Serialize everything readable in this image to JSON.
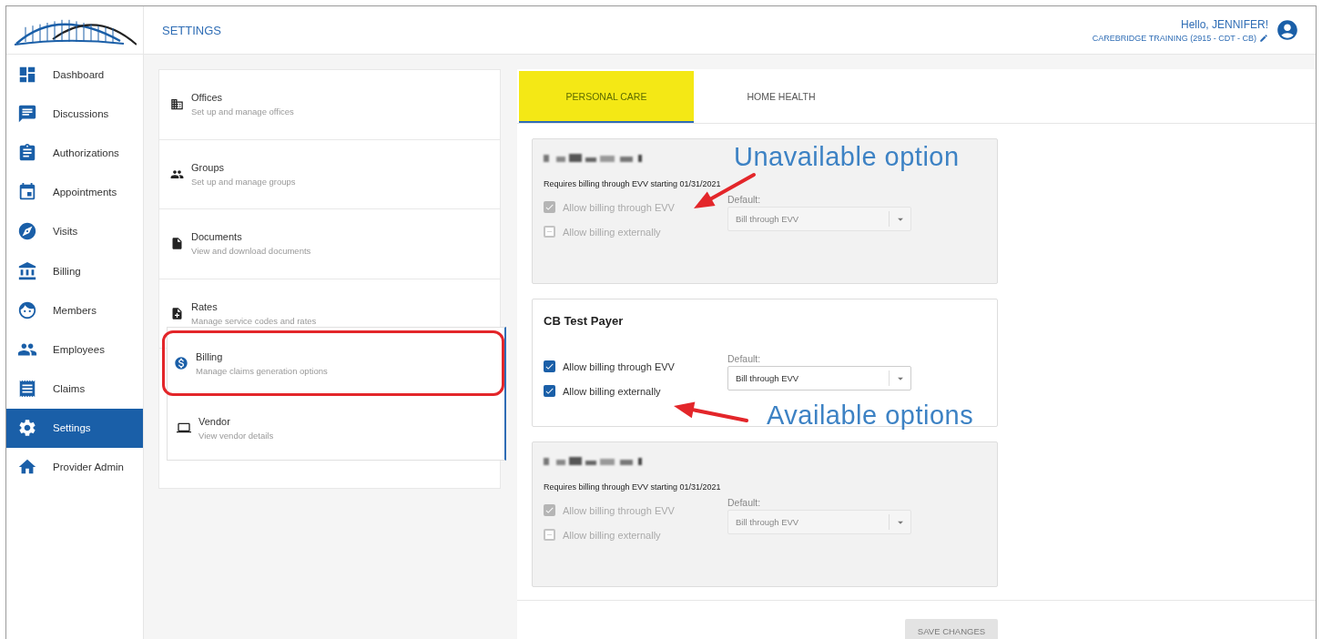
{
  "header": {
    "title": "SETTINGS",
    "greeting": "Hello, JENNIFER!",
    "organization": "CAREBRIDGE TRAINING (2915 - CDT - CB)"
  },
  "sidebar": {
    "items": [
      {
        "label": "Dashboard",
        "selected": false
      },
      {
        "label": "Discussions",
        "selected": false
      },
      {
        "label": "Authorizations",
        "selected": false
      },
      {
        "label": "Appointments",
        "selected": false
      },
      {
        "label": "Visits",
        "selected": false
      },
      {
        "label": "Billing",
        "selected": false
      },
      {
        "label": "Members",
        "selected": false
      },
      {
        "label": "Employees",
        "selected": false
      },
      {
        "label": "Claims",
        "selected": false
      },
      {
        "label": "Settings",
        "selected": true
      },
      {
        "label": "Provider Admin",
        "selected": false
      }
    ]
  },
  "settings_list": [
    {
      "title": "Offices",
      "subtitle": "Set up and manage offices"
    },
    {
      "title": "Groups",
      "subtitle": "Set up and manage groups"
    },
    {
      "title": "Documents",
      "subtitle": "View and download documents"
    },
    {
      "title": "Rates",
      "subtitle": "Manage service codes and rates"
    }
  ],
  "menu_overlay": [
    {
      "title": "Billing",
      "subtitle": "Manage claims generation options",
      "highlighted": true
    },
    {
      "title": "Vendor",
      "subtitle": "View vendor details",
      "highlighted": false
    }
  ],
  "tabs": [
    {
      "label": "PERSONAL CARE",
      "selected": true,
      "highlighted": true
    },
    {
      "label": "HOME HEALTH",
      "selected": false,
      "highlighted": false
    }
  ],
  "payers": [
    {
      "name_redacted": true,
      "notice": "Requires billing through EVV starting 01/31/2021",
      "disabled": true,
      "options": [
        {
          "label": "Allow billing through EVV",
          "checked": true
        },
        {
          "label": "Allow billing externally",
          "checked": false
        }
      ],
      "default_label": "Default:",
      "default_value": "Bill through EVV"
    },
    {
      "name": "CB Test Payer",
      "disabled": false,
      "options": [
        {
          "label": "Allow billing through EVV",
          "checked": true
        },
        {
          "label": "Allow billing externally",
          "checked": true
        }
      ],
      "default_label": "Default:",
      "default_value": "Bill through EVV"
    },
    {
      "name_redacted": true,
      "notice": "Requires billing through EVV starting 01/31/2021",
      "disabled": true,
      "options": [
        {
          "label": "Allow billing through EVV",
          "checked": true
        },
        {
          "label": "Allow billing externally",
          "checked": false
        }
      ],
      "default_label": "Default:",
      "default_value": "Bill through EVV"
    }
  ],
  "save_button": {
    "label": "SAVE CHANGES",
    "disabled": true
  },
  "annotations": [
    {
      "text": "Unavailable option"
    },
    {
      "text": "Available options"
    }
  ]
}
